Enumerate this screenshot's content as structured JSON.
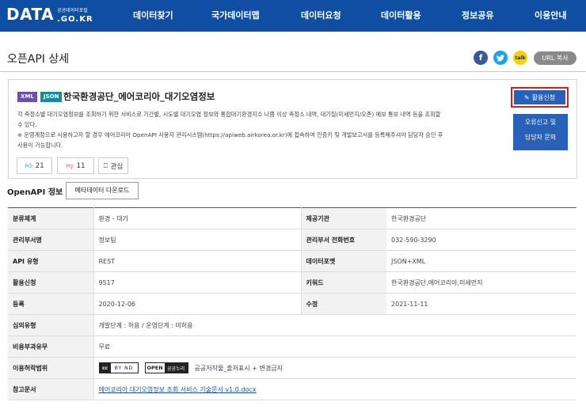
{
  "header": {
    "logo": "DATA",
    "logo_sub": "공공데이터포털",
    "logo_domain": ".GO.KR",
    "nav": [
      "데이터찾기",
      "국가데이터맵",
      "데이터요청",
      "데이터활용",
      "정보공유",
      "이용안내"
    ]
  },
  "page": {
    "title": "오픈API 상세",
    "share": {
      "kakao_label": "talk",
      "url_copy": "URL 복사"
    }
  },
  "dataset": {
    "badges": [
      "XML",
      "JSON"
    ],
    "title": "한국환경공단_에어코리아_대기오염정보",
    "desc1": "각 측정소별 대기오염정보를 조회하기 위한 서비스로 기간별, 시도별 대기오염 정보와 통합대기환경지수 나쁨 이상 측정소 내역, 대기질(미세먼지/오존) 예보 통보 내역 등을 조회할 수 있다.",
    "desc2": "※ 운영계정으로 사용하고자 할 경우 에어코리아 OpenAPI 사용자 관리시스템(https://apiweb.airkorea.or.kr)에 접속하여 인증키 및 개발보고서를 등록해주셔야 담당자 승인 후 사용이 가능합니다.",
    "apply_label": "활용신청",
    "report_line1": "오류신고 및",
    "report_line2": "담당자 문의",
    "likes": "21",
    "dislikes": "11",
    "interest_label": "관심"
  },
  "openapi": {
    "section_title": "OpenAPI 정보",
    "meta_download": "메타데이터 다운로드"
  },
  "table": {
    "rows": [
      {
        "k1": "분류체계",
        "v1": "환경 - 대기",
        "k2": "제공기관",
        "v2": "한국환경공단"
      },
      {
        "k1": "관리부서명",
        "v1": "정보팀",
        "k2": "관리부서 전화번호",
        "v2": "032-590-3290"
      },
      {
        "k1": "API 유형",
        "v1": "REST",
        "k2": "데이터포맷",
        "v2": "JSON+XML"
      },
      {
        "k1": "활용신청",
        "v1": "9517",
        "k2": "키워드",
        "v2": "한국환경공단,에어코리아,미세먼지"
      },
      {
        "k1": "등록",
        "v1": "2020-12-06",
        "k2": "수정",
        "v2": "2021-11-11"
      }
    ],
    "review": {
      "k": "심의유형",
      "v": "개발단계 : 허용 / 운영단계 : 미허용"
    },
    "fee": {
      "k": "비용부과유무",
      "v": "무료"
    },
    "license": {
      "k": "이용허락범위",
      "cc_left": "cc",
      "cc_right": "BY ND",
      "ogl_left": "OPEN",
      "ogl_right": "공공누리",
      "v": "공공저작물_출처표시 + 변경금지"
    },
    "reference": {
      "k": "참고문서",
      "v": "에어코리아 대기오염정보 조회 서비스 기술문서 v1.0.docx"
    }
  }
}
